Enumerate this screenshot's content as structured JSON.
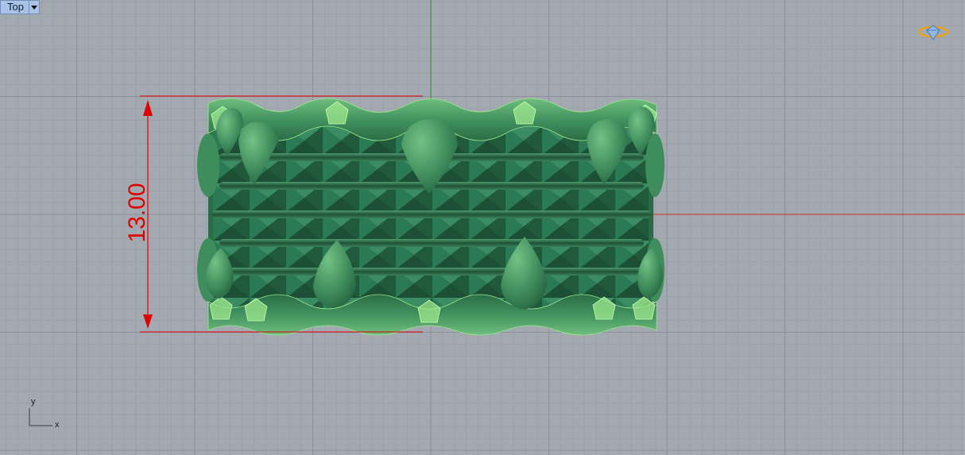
{
  "viewport": {
    "name": "Top",
    "dimension": {
      "value": "13.00",
      "color": "#e00000"
    },
    "axis_widget": {
      "x_label": "x",
      "y_label": "y"
    },
    "colors": {
      "background": "#a3a9b0",
      "grid_minor": "#9aa0a7",
      "grid_major": "#8b9198",
      "world_x_axis": "#c8443f",
      "world_y_axis": "#3f9a4a",
      "model": "#3f8c5c",
      "model_dark": "#23573a",
      "model_highlight": "#9fe88d"
    },
    "nav_widget_icon": "gumball-diamond-icon",
    "model": "ring-band-with-pyramid-texture-and-spikes"
  }
}
